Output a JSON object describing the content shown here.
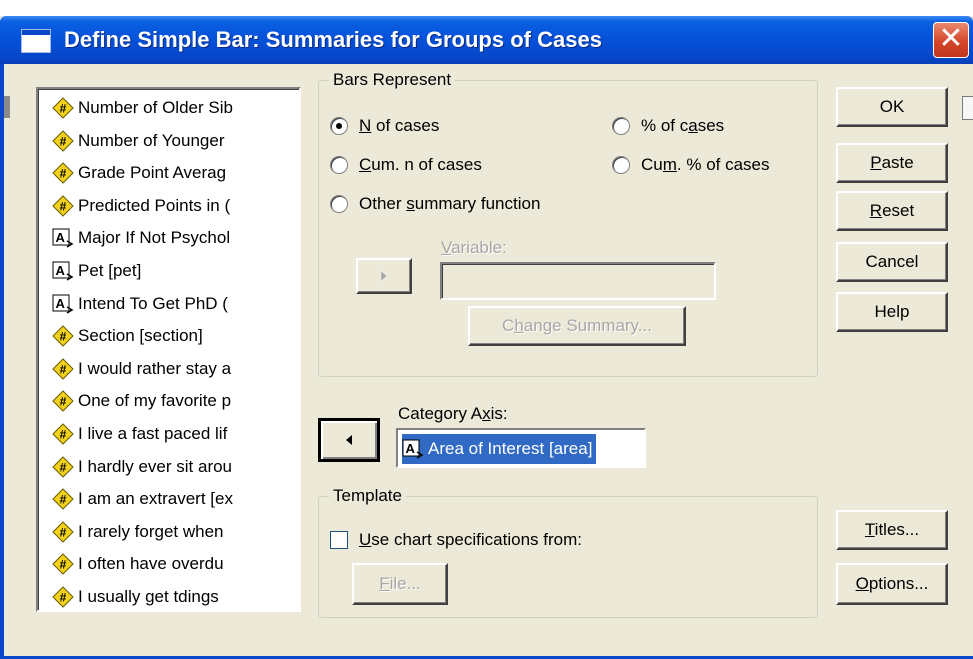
{
  "window": {
    "title": "Define Simple Bar: Summaries for Groups of Cases",
    "close_glyph": "✕"
  },
  "variables": [
    {
      "label": "Number of Older Sib",
      "type": "numeric"
    },
    {
      "label": "Number of Younger",
      "type": "numeric"
    },
    {
      "label": "Grade Point Averag",
      "type": "numeric"
    },
    {
      "label": "Predicted Points in (",
      "type": "numeric"
    },
    {
      "label": "Major If Not Psychol",
      "type": "string"
    },
    {
      "label": "Pet [pet]",
      "type": "string"
    },
    {
      "label": "Intend To Get PhD (",
      "type": "string"
    },
    {
      "label": "Section [section]",
      "type": "numeric"
    },
    {
      "label": "I would rather stay a",
      "type": "numeric"
    },
    {
      "label": "One of my favorite p",
      "type": "numeric"
    },
    {
      "label": "I live a fast paced lif",
      "type": "numeric"
    },
    {
      "label": "I hardly ever sit arou",
      "type": "numeric"
    },
    {
      "label": "I am an extravert [ex",
      "type": "numeric"
    },
    {
      "label": "I rarely forget when",
      "type": "numeric"
    },
    {
      "label": "I often have overdu",
      "type": "numeric"
    },
    {
      "label": "I usually get tdings",
      "type": "numeric"
    }
  ],
  "bars_represent": {
    "legend": "Bars Represent",
    "options": [
      {
        "label_pre": "",
        "accel": "N",
        "label_post": " of cases",
        "selected": true
      },
      {
        "label_pre": "",
        "accel": "C",
        "label_post": "um. n of cases",
        "selected": false
      },
      {
        "label_pre": "Other ",
        "accel": "s",
        "label_post": "ummary function",
        "selected": false
      },
      {
        "label_pre": "% of c",
        "accel": "a",
        "label_post": "ses",
        "selected": false
      },
      {
        "label_pre": "Cu",
        "accel": "m",
        "label_post": ". % of cases",
        "selected": false
      }
    ],
    "variable_label_accel": "V",
    "variable_label_rest": "ariable:",
    "change_summary_pre": "C",
    "change_summary_accel": "h",
    "change_summary_post": "ange Summary..."
  },
  "category_axis": {
    "label_pre": "Category A",
    "label_accel": "x",
    "label_post": "is:",
    "value": "Area of Interest [area]"
  },
  "template": {
    "legend": "Template",
    "checkbox_accel": "U",
    "checkbox_rest": "se chart specifications from:",
    "checked": false,
    "file_accel": "F",
    "file_rest": "ile..."
  },
  "buttons": {
    "ok": "OK",
    "paste_accel": "P",
    "paste_rest": "aste",
    "reset_accel": "R",
    "reset_rest": "eset",
    "cancel": "Cancel",
    "help": "Help",
    "titles_accel": "T",
    "titles_rest": "itles...",
    "options_accel": "O",
    "options_rest": "ptions..."
  },
  "colors": {
    "titlebar": "#0551da",
    "dialog_bg": "#ece9d8",
    "selection": "#316ac5",
    "numeric_icon": "#f2d21b",
    "string_icon_ink": "#000000"
  }
}
